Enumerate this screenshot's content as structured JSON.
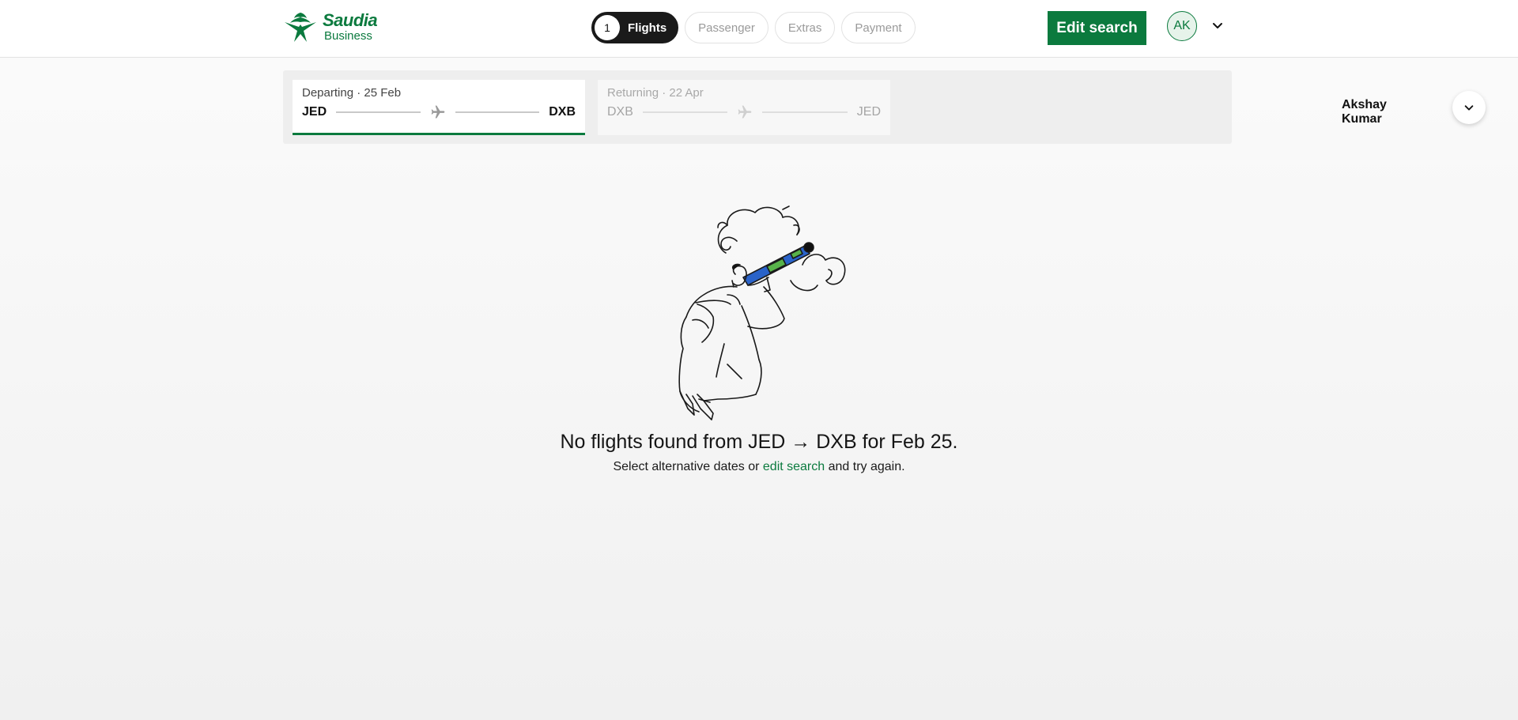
{
  "header": {
    "logo": {
      "name": "Saudia",
      "subtitle": "Business",
      "icon": "saudia-palm-swords-logo"
    },
    "steps": [
      {
        "number": "1",
        "label": "Flights",
        "active": true
      },
      {
        "label": "Passenger",
        "active": false
      },
      {
        "label": "Extras",
        "active": false
      },
      {
        "label": "Payment",
        "active": false
      }
    ],
    "edit_search_label": "Edit search",
    "avatar_initials": "AK",
    "avatar_menu_icon": "chevron-down-icon"
  },
  "trip": {
    "outbound": {
      "label": "Departing · 25 Feb",
      "from": "JED",
      "to": "DXB",
      "icon": "airplane-icon"
    },
    "return": {
      "label": "Returning · 22 Apr",
      "from": "DXB",
      "to": "JED",
      "icon": "airplane-icon"
    },
    "passenger_name": "Akshay Kumar",
    "passenger_toggle_icon": "chevron-down-icon"
  },
  "empty_state": {
    "illustration": "man-with-telescope-in-clouds",
    "title": "No flights found from JED → DXB for Feb 25.",
    "subtitle_before": "Select alternative dates or",
    "subtitle_link": "edit search",
    "subtitle_after": "and try again."
  },
  "colors": {
    "brand_green": "#0b7a3e",
    "active_step": "#1a1a1a"
  }
}
